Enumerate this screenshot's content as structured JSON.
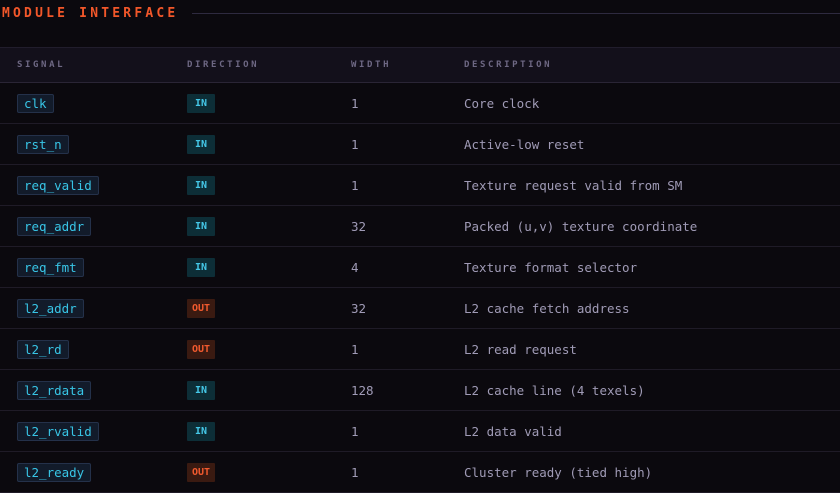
{
  "section": {
    "title": "MODULE INTERFACE"
  },
  "table": {
    "headers": {
      "signal": "SIGNAL",
      "direction": "DIRECTION",
      "width": "WIDTH",
      "description": "DESCRIPTION"
    },
    "rows": [
      {
        "signal": "clk",
        "direction": "IN",
        "width": "1",
        "description": "Core clock"
      },
      {
        "signal": "rst_n",
        "direction": "IN",
        "width": "1",
        "description": "Active-low reset"
      },
      {
        "signal": "req_valid",
        "direction": "IN",
        "width": "1",
        "description": "Texture request valid from SM"
      },
      {
        "signal": "req_addr",
        "direction": "IN",
        "width": "32",
        "description": "Packed (u,v) texture coordinate"
      },
      {
        "signal": "req_fmt",
        "direction": "IN",
        "width": "4",
        "description": "Texture format selector"
      },
      {
        "signal": "l2_addr",
        "direction": "OUT",
        "width": "32",
        "description": "L2 cache fetch address"
      },
      {
        "signal": "l2_rd",
        "direction": "OUT",
        "width": "1",
        "description": "L2 read request"
      },
      {
        "signal": "l2_rdata",
        "direction": "IN",
        "width": "128",
        "description": "L2 cache line (4 texels)"
      },
      {
        "signal": "l2_rvalid",
        "direction": "IN",
        "width": "1",
        "description": "L2 data valid"
      },
      {
        "signal": "l2_ready",
        "direction": "OUT",
        "width": "1",
        "description": "Cluster ready (tied high)"
      }
    ]
  },
  "colors": {
    "accent": "#f2572a",
    "in_badge": "#45c8e8",
    "out_badge": "#f25a2e",
    "signal": "#38c5e6"
  }
}
